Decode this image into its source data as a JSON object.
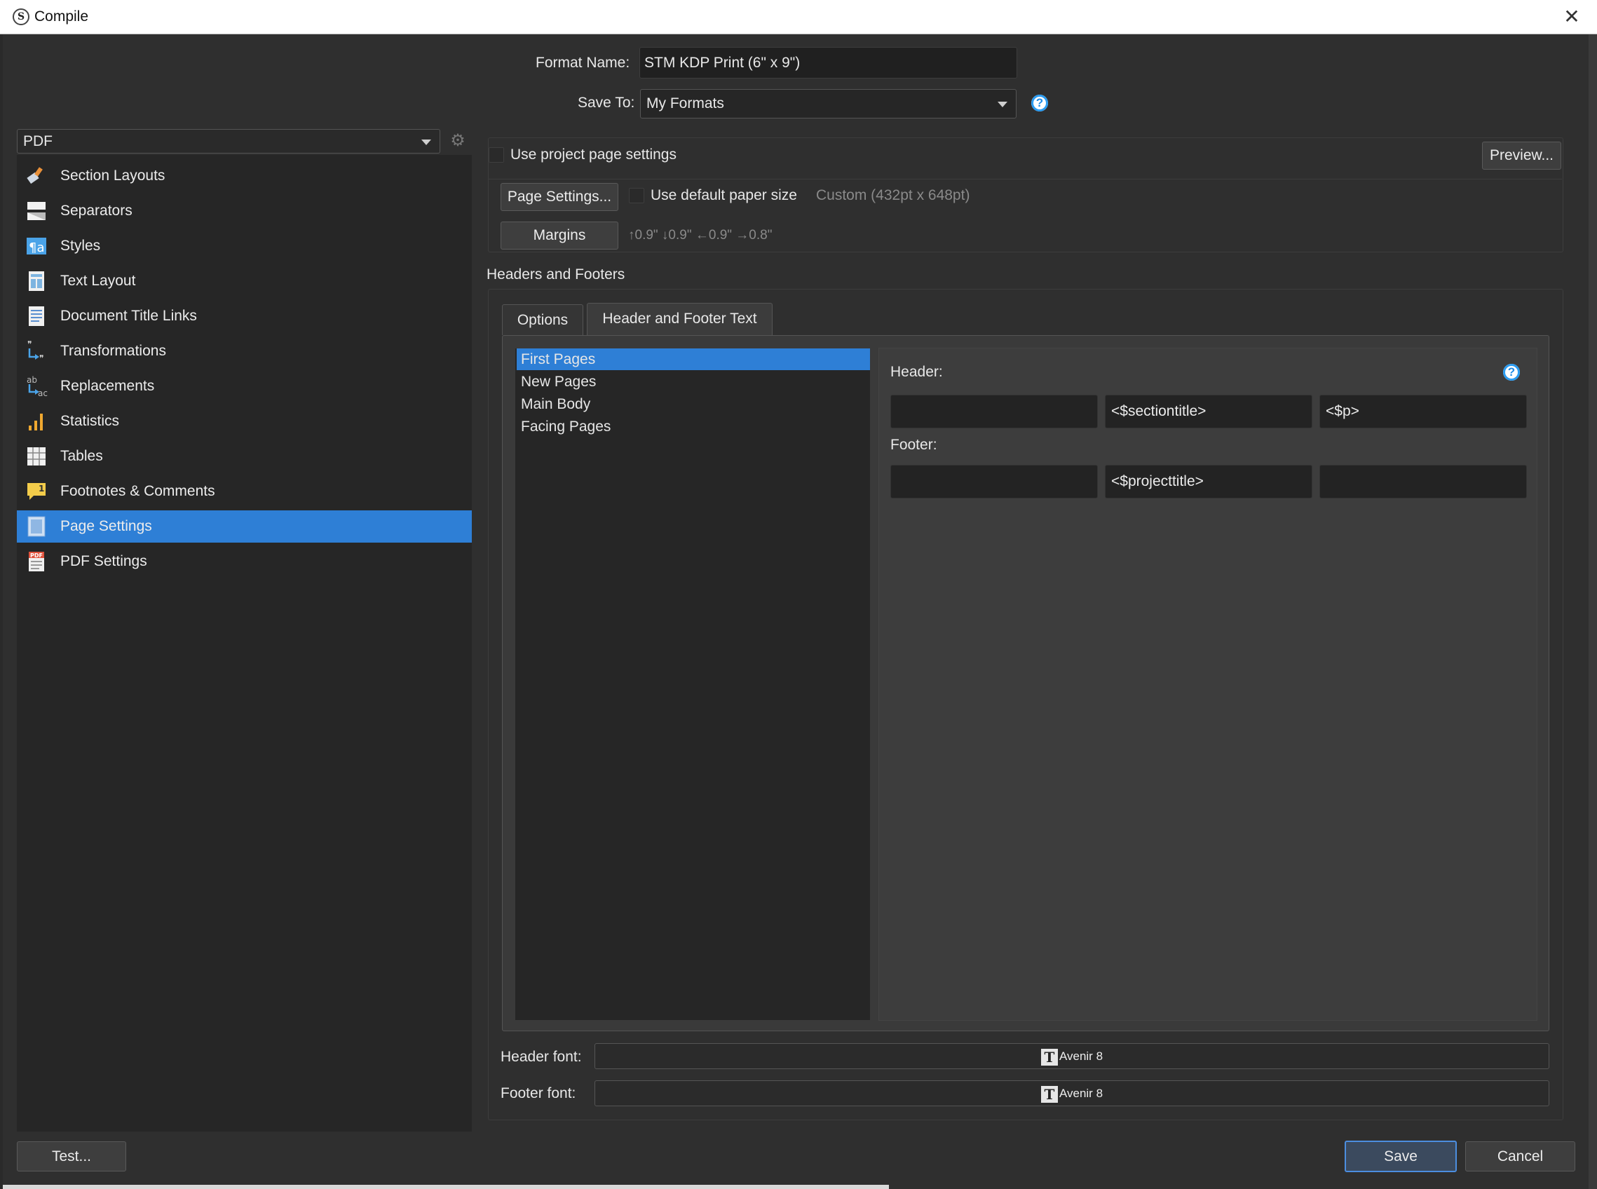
{
  "window": {
    "title": "Compile",
    "app_icon_glyph": "S",
    "close_glyph": "✕"
  },
  "format": {
    "name_label": "Format Name:",
    "name_value": "STM KDP Print (6\" x 9\")",
    "save_to_label": "Save To:",
    "save_to_value": "My Formats",
    "help_glyph": "?"
  },
  "sidebar": {
    "compile_for": "PDF",
    "gear_glyph": "⚙",
    "items": [
      {
        "label": "Section Layouts",
        "icon": "section-layouts-icon"
      },
      {
        "label": "Separators",
        "icon": "separators-icon"
      },
      {
        "label": "Styles",
        "icon": "styles-icon"
      },
      {
        "label": "Text Layout",
        "icon": "text-layout-icon"
      },
      {
        "label": "Document Title Links",
        "icon": "document-title-links-icon"
      },
      {
        "label": "Transformations",
        "icon": "transformations-icon"
      },
      {
        "label": "Replacements",
        "icon": "replacements-icon"
      },
      {
        "label": "Statistics",
        "icon": "statistics-icon"
      },
      {
        "label": "Tables",
        "icon": "tables-icon"
      },
      {
        "label": "Footnotes & Comments",
        "icon": "footnotes-comments-icon"
      },
      {
        "label": "Page Settings",
        "icon": "page-settings-icon",
        "selected": true
      },
      {
        "label": "PDF Settings",
        "icon": "pdf-settings-icon"
      }
    ]
  },
  "page_settings": {
    "use_project_label": "Use project page settings",
    "preview_button": "Preview...",
    "page_settings_button": "Page Settings...",
    "use_default_paper_label": "Use default paper size",
    "paper_size_text": "Custom (432pt x 648pt)",
    "margins_button": "Margins",
    "margins_text": "↑0.9\" ↓0.9\" ←0.9\" →0.8\""
  },
  "headers_footers": {
    "section_title": "Headers and Footers",
    "tabs": [
      {
        "label": "Options",
        "active": false
      },
      {
        "label": "Header and Footer Text",
        "active": true
      }
    ],
    "page_types": [
      {
        "label": "First Pages",
        "selected": true
      },
      {
        "label": "New Pages",
        "selected": false
      },
      {
        "label": "Main Body",
        "selected": false
      },
      {
        "label": "Facing Pages",
        "selected": false
      }
    ],
    "header_label": "Header:",
    "header_fields": [
      "",
      "<$sectiontitle>",
      "<$p>"
    ],
    "footer_label": "Footer:",
    "footer_fields": [
      "",
      "<$projecttitle>",
      ""
    ],
    "header_font_label": "Header font:",
    "header_font_value": "Avenir 8",
    "footer_font_label": "Footer font:",
    "footer_font_value": "Avenir 8",
    "font_icon_glyph": "T"
  },
  "footer_buttons": {
    "test": "Test...",
    "save": "Save",
    "cancel": "Cancel"
  }
}
